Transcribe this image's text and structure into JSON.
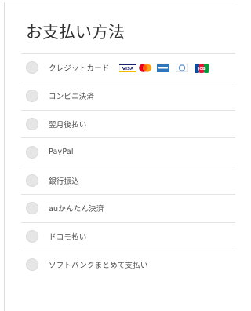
{
  "header": {
    "title": "お支払い方法"
  },
  "payment_methods": [
    {
      "label": "クレジットカード",
      "cards": [
        {
          "icon": "visa-icon",
          "text": "VISA"
        },
        {
          "icon": "mastercard-icon"
        },
        {
          "icon": "amex-icon"
        },
        {
          "icon": "diners-icon"
        },
        {
          "icon": "jcb-icon",
          "text": "JCB"
        }
      ]
    },
    {
      "label": "コンビニ決済"
    },
    {
      "label": "翌月後払い"
    },
    {
      "label": "PayPal"
    },
    {
      "label": "銀行振込"
    },
    {
      "label": "auかんたん決済"
    },
    {
      "label": "ドコモ払い"
    },
    {
      "label": "ソフトバンクまとめて支払い"
    }
  ]
}
